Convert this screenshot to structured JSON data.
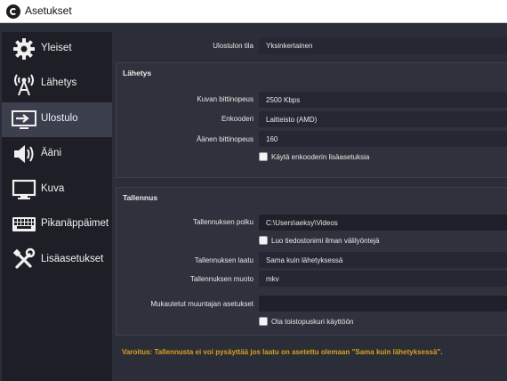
{
  "window": {
    "title": "Asetukset"
  },
  "sidebar": {
    "items": [
      {
        "label": "Yleiset",
        "icon": "gear-icon"
      },
      {
        "label": "Lähetys",
        "icon": "antenna-icon"
      },
      {
        "label": "Ulostulo",
        "icon": "output-icon"
      },
      {
        "label": "Ääni",
        "icon": "speaker-icon"
      },
      {
        "label": "Kuva",
        "icon": "monitor-icon"
      },
      {
        "label": "Pikanäppäimet",
        "icon": "keyboard-icon"
      },
      {
        "label": "Lisäasetukset",
        "icon": "tools-icon"
      }
    ],
    "active": "Ulostulo"
  },
  "output_mode": {
    "label": "Ulostulon tila",
    "value": "Yksinkertainen"
  },
  "streaming": {
    "title": "Lähetys",
    "video_bitrate": {
      "label": "Kuvan bittinopeus",
      "value": "2500 Kbps"
    },
    "encoder": {
      "label": "Enkooderi",
      "value": "Laitteisto (AMD)"
    },
    "audio_bitrate": {
      "label": "Äänen bittinopeus",
      "value": "160"
    },
    "advanced_encoder": {
      "label": "Käytä enkooderin lisäasetuksia",
      "checked": false
    }
  },
  "recording": {
    "title": "Tallennus",
    "path": {
      "label": "Tallennuksen polku",
      "value": "C:\\Users\\aeksy\\Videos"
    },
    "no_space": {
      "label": "Luo tiedostonimi ilman välilyöntejä",
      "checked": false
    },
    "quality": {
      "label": "Tallennuksen laatu",
      "value": "Sama kuin lähetyksessä"
    },
    "format": {
      "label": "Tallennuksen muoto",
      "value": "mkv"
    },
    "muxer": {
      "label": "Mukautetut muuntajan asetukset",
      "value": ""
    },
    "replay_buffer": {
      "label": "Ota toistopuskuri käyttöön",
      "checked": false
    }
  },
  "warning": "Varoitus: Tallennusta ei voi pysäyttää jos laatu on asetettu olemaan \"Sama kuin lähetyksessä\".",
  "colors": {
    "sidebar_bg": "#1e1f26",
    "content_bg": "#2b2e38",
    "active_item": "#3c404e",
    "warning": "#d8a11b"
  }
}
